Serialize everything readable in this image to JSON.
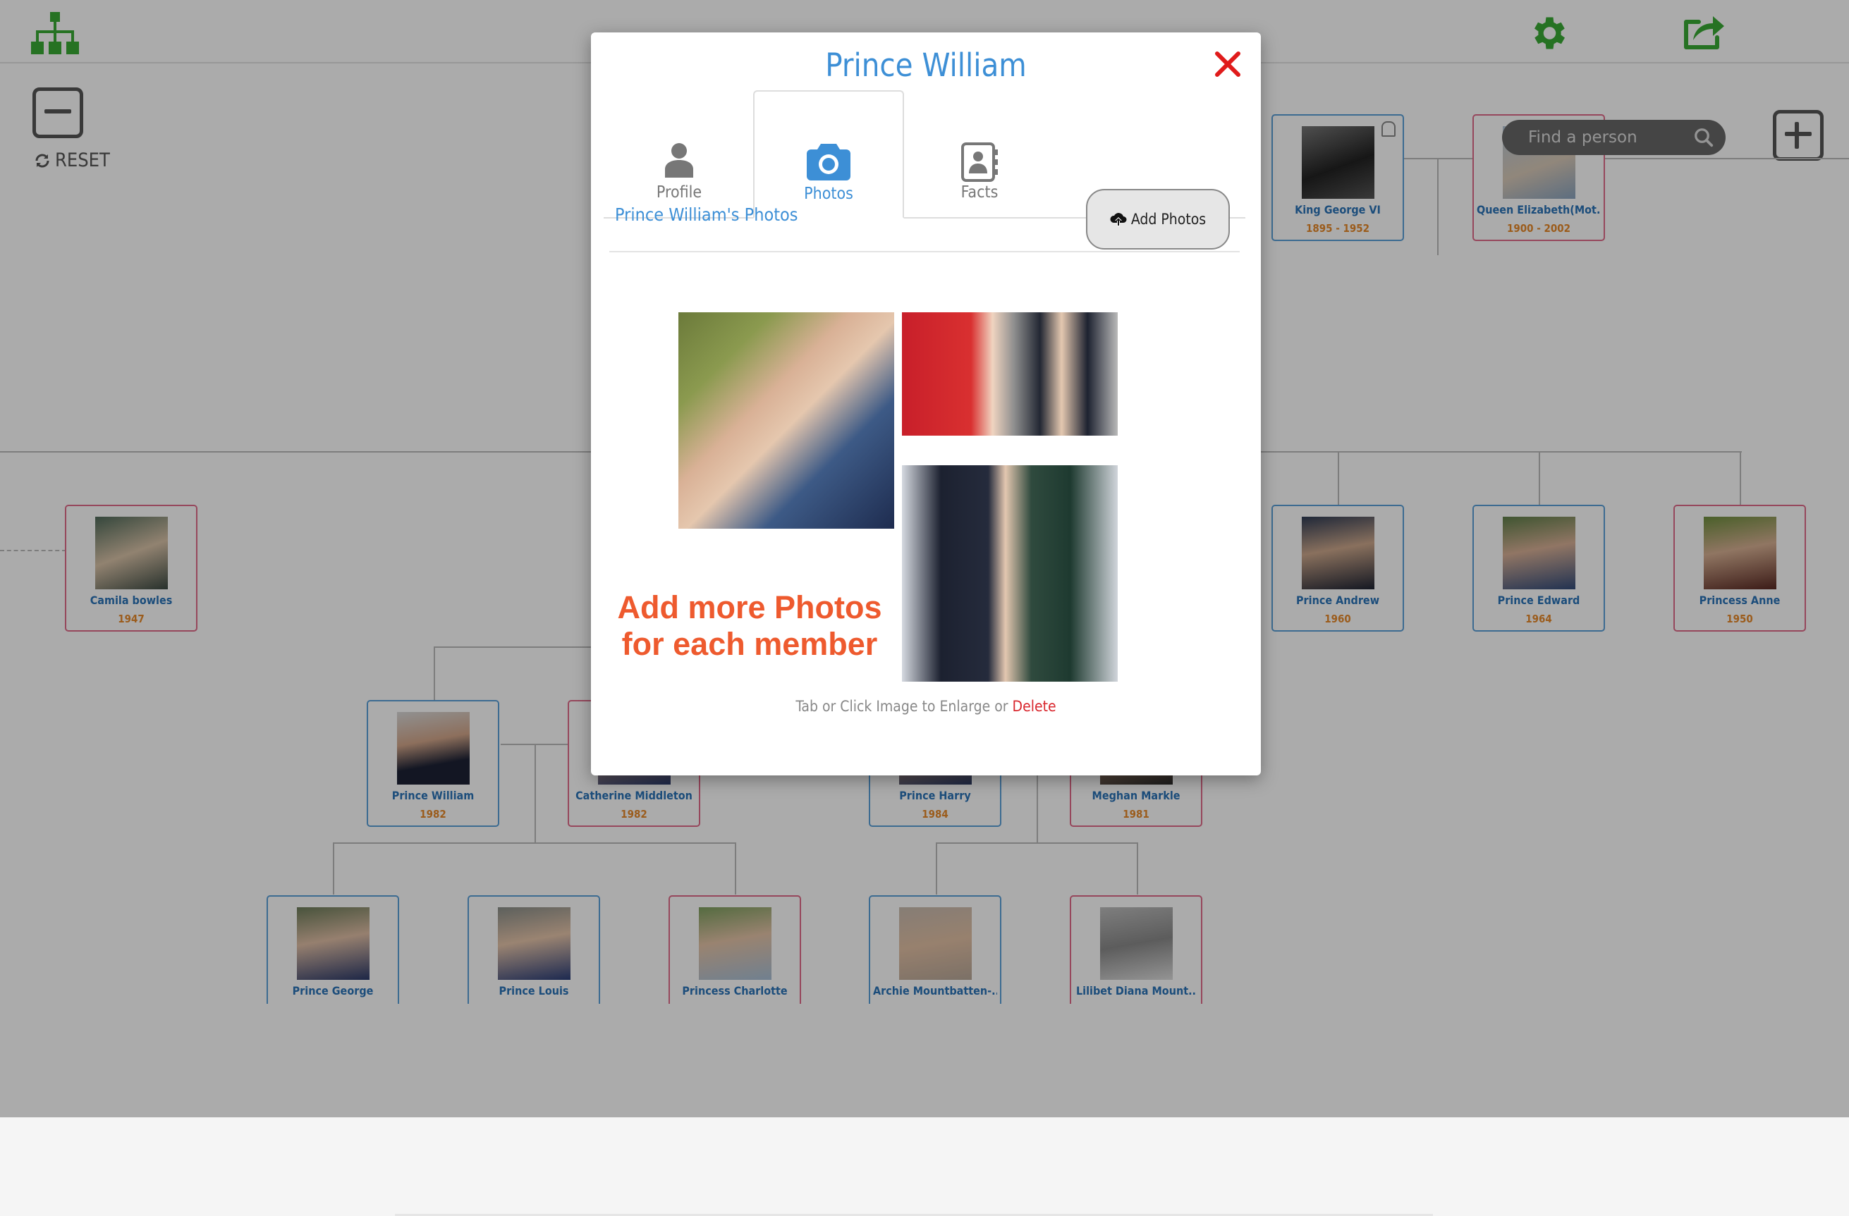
{
  "toolbar": {
    "tree_icon": "org-chart-icon",
    "settings_icon": "gear-icon",
    "share_icon": "share-icon",
    "zoom_out_icon": "minus-square-icon",
    "zoom_in_icon": "plus-square-icon",
    "reset_label": "RESET",
    "search_placeholder": "Find a person",
    "accent_color": "#3aaa35"
  },
  "tree": {
    "people": [
      {
        "name": "King George VI",
        "years": "1895 - 1952",
        "gender": "male",
        "deceased": true
      },
      {
        "name": "Queen Elizabeth(Mot..",
        "years": "1900 - 2002",
        "gender": "female",
        "deceased": true
      },
      {
        "name": "Camila bowles",
        "years": "1947",
        "gender": "female"
      },
      {
        "name": "Prince Andrew",
        "years": "1960",
        "gender": "male"
      },
      {
        "name": "Prince Edward",
        "years": "1964",
        "gender": "male"
      },
      {
        "name": "Princess Anne",
        "years": "1950",
        "gender": "female"
      },
      {
        "name": "Prince William",
        "years": "1982",
        "gender": "male"
      },
      {
        "name": "Catherine Middleton",
        "years": "1982",
        "gender": "female"
      },
      {
        "name": "Prince Harry",
        "years": "1984",
        "gender": "male"
      },
      {
        "name": "Meghan Markle",
        "years": "1981",
        "gender": "female"
      },
      {
        "name": "Prince George",
        "years": "",
        "gender": "male"
      },
      {
        "name": "Prince Louis",
        "years": "",
        "gender": "male"
      },
      {
        "name": "Princess Charlotte",
        "years": "",
        "gender": "female"
      },
      {
        "name": "Archie Mountbatten-..",
        "years": "",
        "gender": "male"
      },
      {
        "name": "Lilibet Diana Mount..",
        "years": "",
        "gender": "female"
      }
    ]
  },
  "modal": {
    "title": "Prince William",
    "close_icon": "close-icon",
    "tabs": [
      {
        "label": "Profile",
        "icon": "user-icon",
        "active": false
      },
      {
        "label": "Photos",
        "icon": "camera-icon",
        "active": true
      },
      {
        "label": "Facts",
        "icon": "address-book-icon",
        "active": false
      }
    ],
    "photos_heading": "Prince William's Photos",
    "add_photos_label": "Add Photos",
    "promo_line1": "Add more Photos",
    "promo_line2": "for each member",
    "hint_text": "Tab or Click Image to Enlarge or",
    "delete_label": "Delete",
    "title_color": "#3d8fd6",
    "promo_color": "#ee5a2e"
  }
}
